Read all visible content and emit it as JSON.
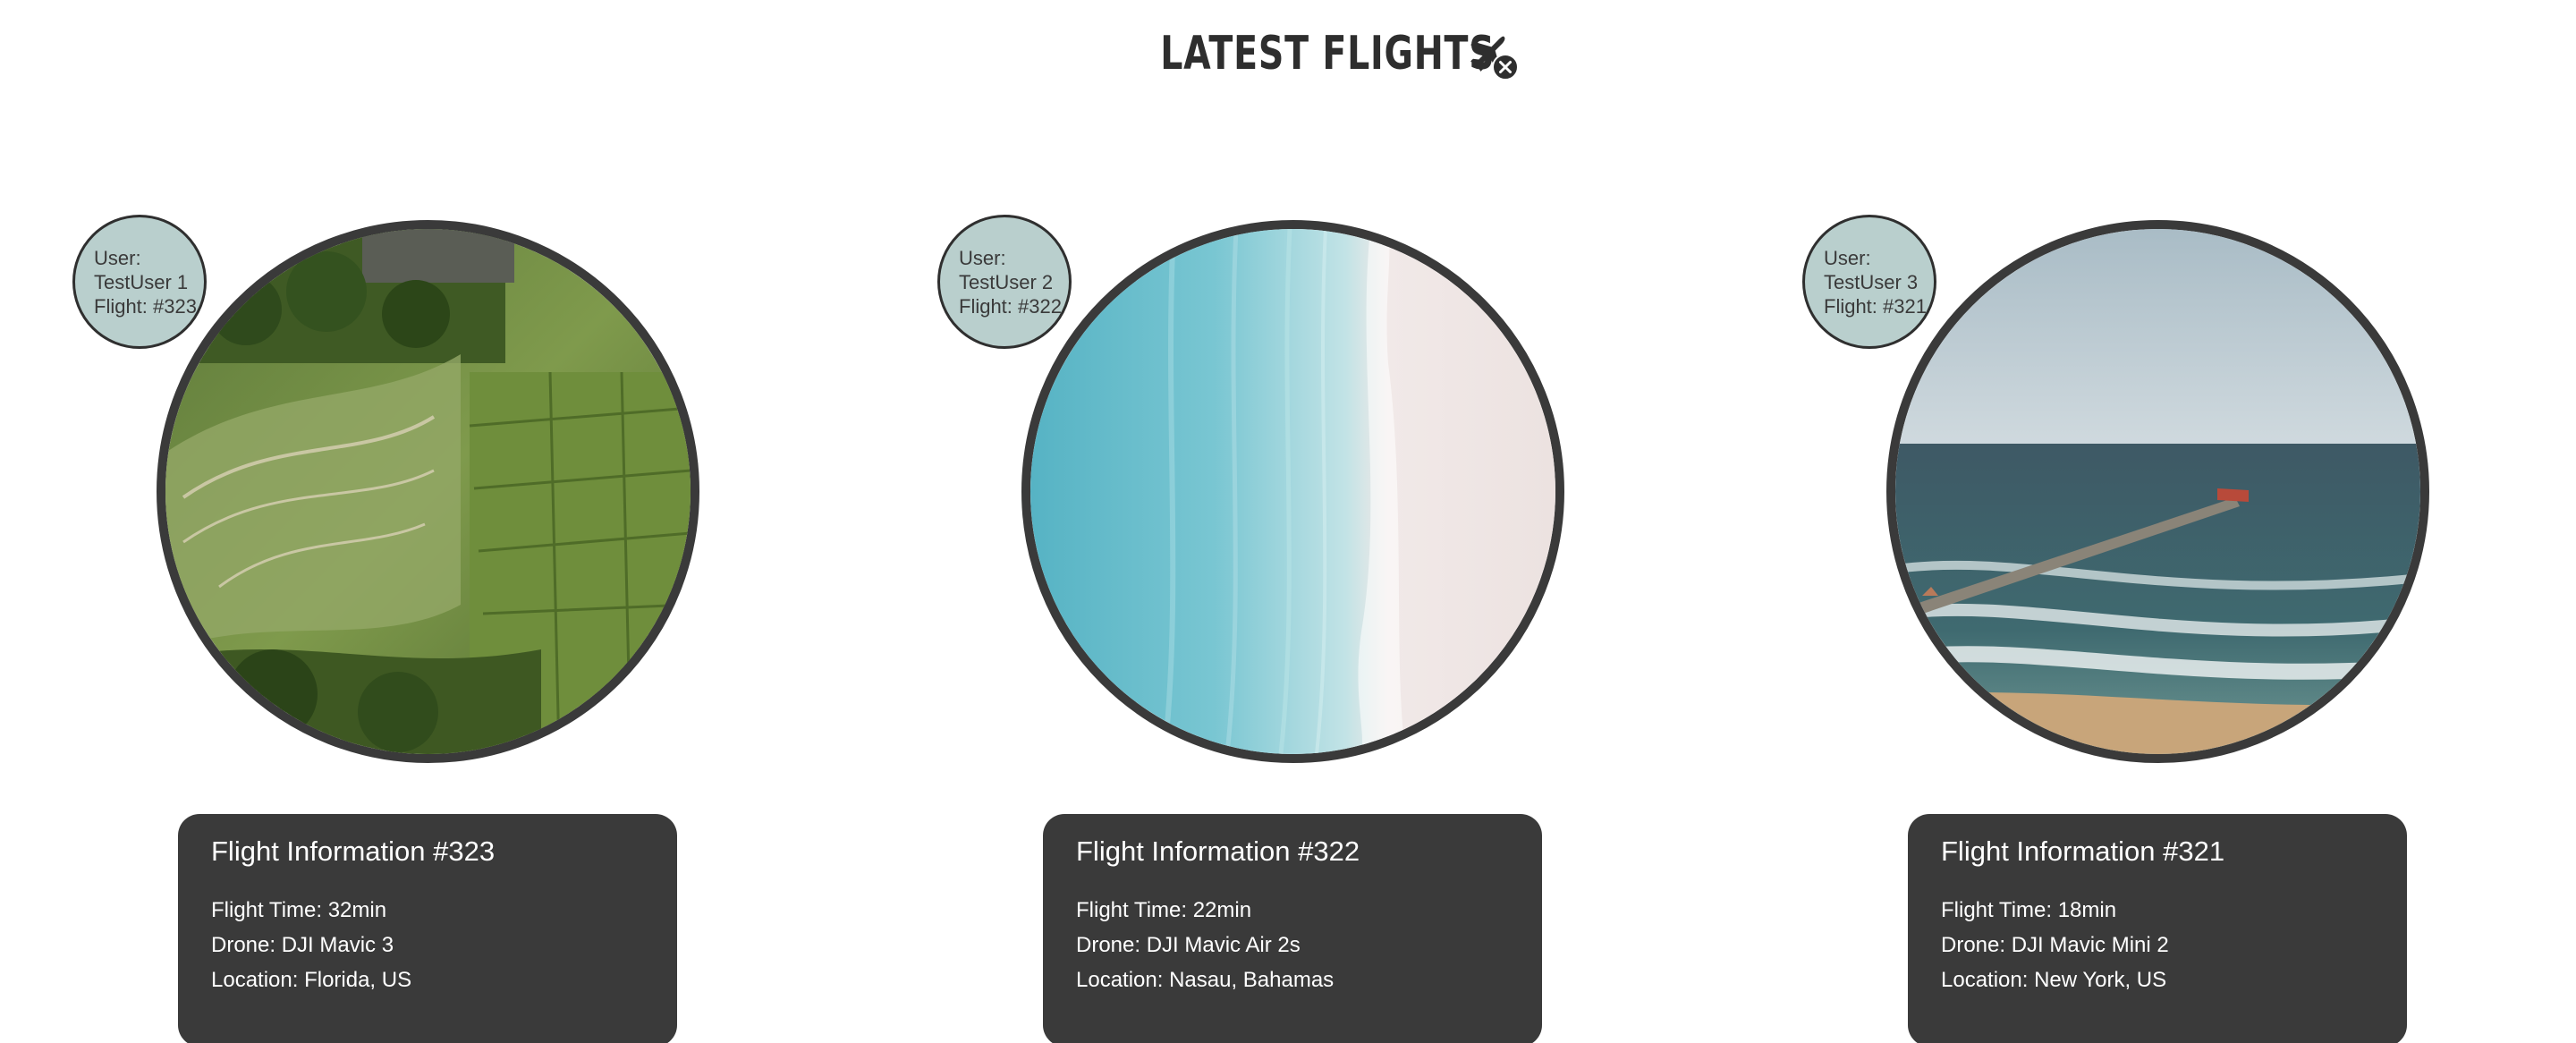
{
  "header": {
    "title": "LATEST FLIGHTS",
    "icon": "airplane-cancel-icon"
  },
  "flights": [
    {
      "user_label": "User:",
      "user_name": "TestUser 1",
      "flight_label": "Flight: #323",
      "photo": "rice-terraces-aerial",
      "info_title": "Flight Information #323",
      "flight_time": "Flight Time: 32min",
      "drone": "Drone: DJI Mavic 3",
      "location": "Location: Florida, US"
    },
    {
      "user_label": "User:",
      "user_name": "TestUser 2",
      "flight_label": "Flight: #322",
      "photo": "beach-shoreline-aerial",
      "info_title": "Flight Information #322",
      "flight_time": "Flight Time: 22min",
      "drone": "Drone: DJI Mavic Air 2s",
      "location": "Location: Nasau, Bahamas"
    },
    {
      "user_label": "User:",
      "user_name": "TestUser 3",
      "flight_label": "Flight: #321",
      "photo": "ocean-pier-aerial",
      "info_title": "Flight Information #321",
      "flight_time": "Flight Time: 18min",
      "drone": "Drone: DJI Mavic Mini 2",
      "location": "Location: New York, US"
    }
  ],
  "colors": {
    "panel": "#3a3a3a",
    "bubble": "#b9cfcd",
    "border": "#3a3a3a"
  }
}
